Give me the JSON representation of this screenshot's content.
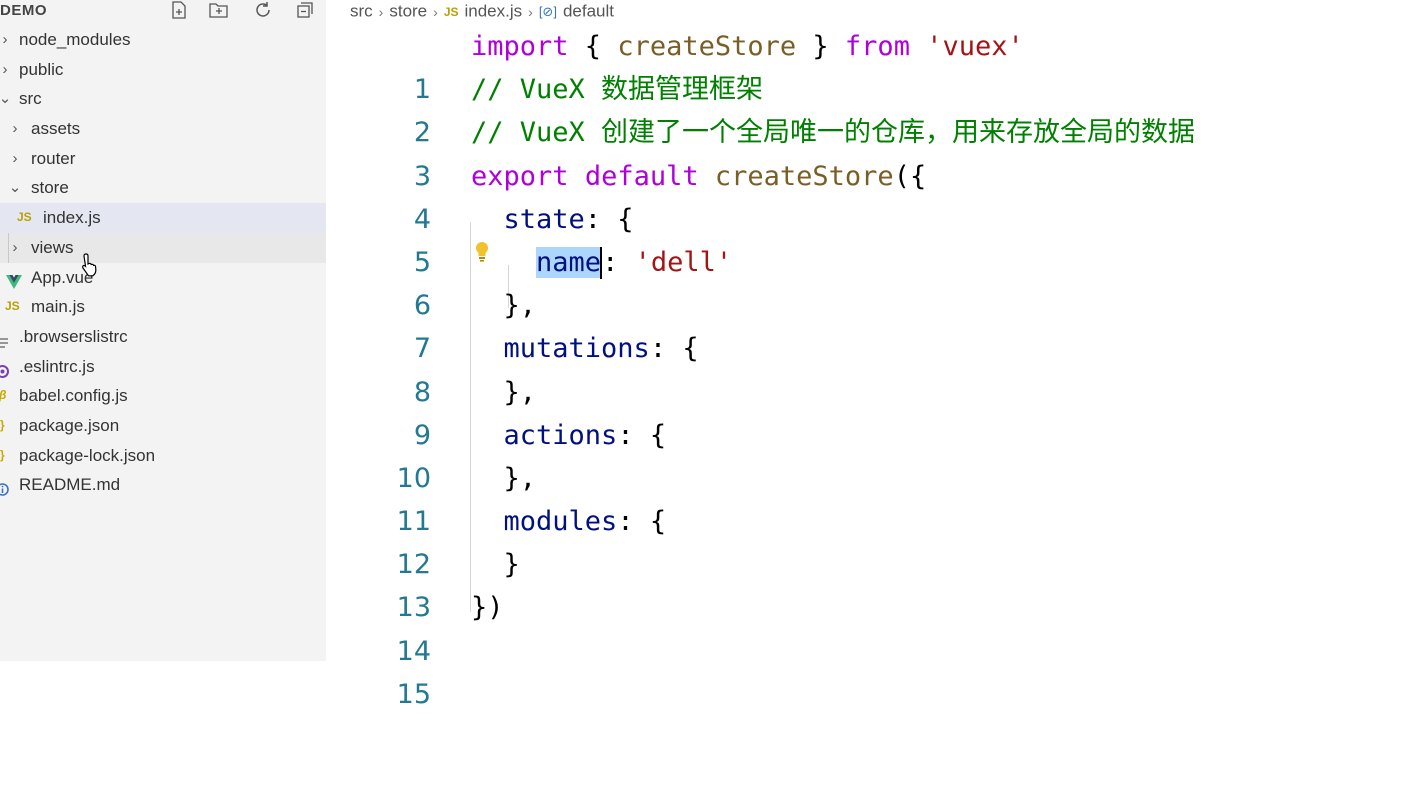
{
  "sidebar": {
    "title": "DEMO",
    "tree": [
      {
        "label": "node_modules",
        "type": "folder",
        "expanded": false,
        "depth": 0
      },
      {
        "label": "public",
        "type": "folder",
        "expanded": false,
        "depth": 0
      },
      {
        "label": "src",
        "type": "folder",
        "expanded": true,
        "depth": 0
      },
      {
        "label": "assets",
        "type": "folder",
        "expanded": false,
        "depth": 1
      },
      {
        "label": "router",
        "type": "folder",
        "expanded": false,
        "depth": 1
      },
      {
        "label": "store",
        "type": "folder",
        "expanded": true,
        "depth": 1
      },
      {
        "label": "index.js",
        "type": "js",
        "depth": 2,
        "selected": true
      },
      {
        "label": "views",
        "type": "folder",
        "expanded": false,
        "depth": 1
      },
      {
        "label": "App.vue",
        "type": "vue",
        "depth": 1
      },
      {
        "label": "main.js",
        "type": "js",
        "depth": 1
      },
      {
        "label": ".browserslistrc",
        "type": "text",
        "depth": 0
      },
      {
        "label": ".eslintrc.js",
        "type": "eslint",
        "depth": 0
      },
      {
        "label": "babel.config.js",
        "type": "babel",
        "depth": 0
      },
      {
        "label": "package.json",
        "type": "json",
        "depth": 0
      },
      {
        "label": "package-lock.json",
        "type": "json",
        "depth": 0
      },
      {
        "label": "README.md",
        "type": "info",
        "depth": 0
      }
    ]
  },
  "breadcrumb": {
    "items": [
      "src",
      "store",
      "index.js",
      "default"
    ],
    "js_icon": "JS"
  },
  "editor": {
    "lines": [
      {
        "n": "1"
      },
      {
        "n": "2"
      },
      {
        "n": "3"
      },
      {
        "n": "4"
      },
      {
        "n": "5"
      },
      {
        "n": "6"
      },
      {
        "n": "7"
      },
      {
        "n": "8"
      },
      {
        "n": "9"
      },
      {
        "n": "10"
      },
      {
        "n": "11"
      },
      {
        "n": "12"
      },
      {
        "n": "13"
      },
      {
        "n": "14"
      },
      {
        "n": "15"
      }
    ],
    "code": {
      "l1_kw1": "import",
      "l1_p1": " { ",
      "l1_fn": "createStore",
      "l1_p2": " } ",
      "l1_kw2": "from",
      "l1_str": "'vuex'",
      "l2": "// VueX 数据管理框架",
      "l3": "// VueX 创建了一个全局唯一的仓库，用来存放全局的数据",
      "l4_kw1": "export",
      "l4_kw2": "default",
      "l4_fn": "createStore",
      "l4_p": "({",
      "l5_prop": "state",
      "l5_p": ": {",
      "l6_prop": "name",
      "l6_p": ": ",
      "l6_str": "'dell'",
      "l7": "},",
      "l8_prop": "mutations",
      "l8_p": ": {",
      "l9": "},",
      "l10_prop": "actions",
      "l10_p": ": {",
      "l11": "},",
      "l12_prop": "modules",
      "l12_p": ": {",
      "l13": "}",
      "l14": "})"
    }
  },
  "colors": {
    "keyword": "#af00db",
    "function": "#795e26",
    "string": "#a31515",
    "comment": "#008000",
    "property": "#001080",
    "line_number": "#237893",
    "selection": "#add6ff"
  }
}
